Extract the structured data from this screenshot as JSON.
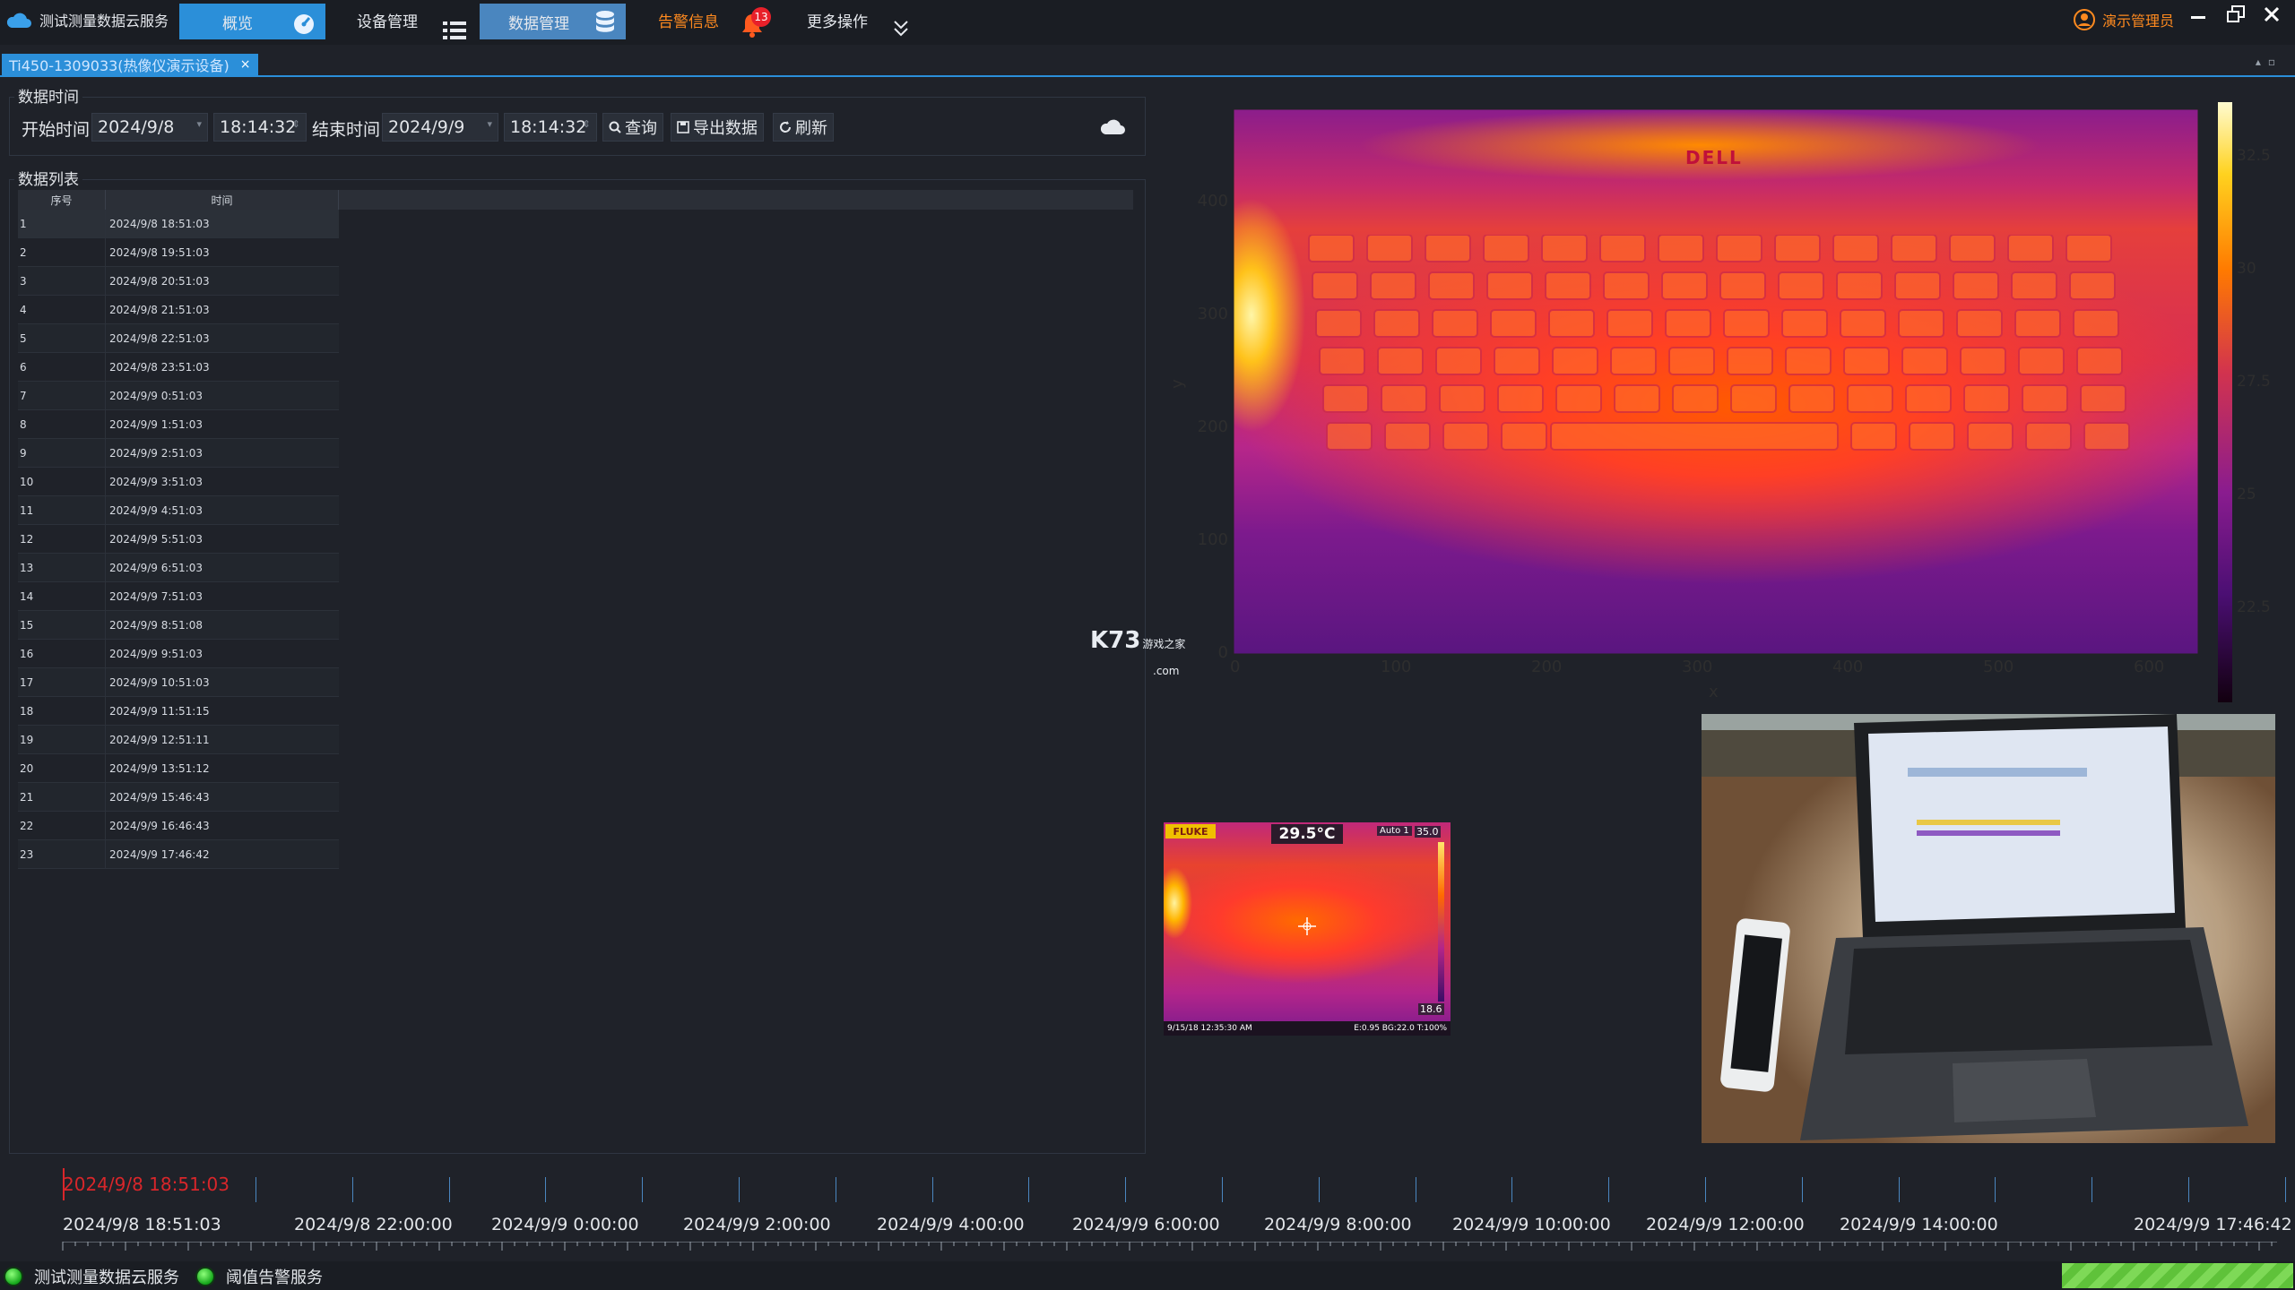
{
  "app": {
    "title": "测试测量数据云服务"
  },
  "nav": {
    "overview": "概览",
    "device_mgmt": "设备管理",
    "data_mgmt": "数据管理",
    "alarm_info": "告警信息",
    "alarm_count": "13",
    "more_ops": "更多操作"
  },
  "user": {
    "name": "演示管理员"
  },
  "tab": {
    "label": "Ti450-1309033(热像仪演示设备)",
    "close": "×"
  },
  "time_group": {
    "title": "数据时间",
    "start_label": "开始时间",
    "start_date": "2024/9/8",
    "start_time": "18:14:32",
    "end_label": "结束时间",
    "end_date": "2024/9/9",
    "end_time": "18:14:32",
    "query": "查询",
    "export": "导出数据",
    "refresh": "刷新"
  },
  "list_group": {
    "title": "数据列表",
    "columns": [
      "序号",
      "时间"
    ],
    "rows": [
      [
        "1",
        "2024/9/8 18:51:03"
      ],
      [
        "2",
        "2024/9/8 19:51:03"
      ],
      [
        "3",
        "2024/9/8 20:51:03"
      ],
      [
        "4",
        "2024/9/8 21:51:03"
      ],
      [
        "5",
        "2024/9/8 22:51:03"
      ],
      [
        "6",
        "2024/9/8 23:51:03"
      ],
      [
        "7",
        "2024/9/9 0:51:03"
      ],
      [
        "8",
        "2024/9/9 1:51:03"
      ],
      [
        "9",
        "2024/9/9 2:51:03"
      ],
      [
        "10",
        "2024/9/9 3:51:03"
      ],
      [
        "11",
        "2024/9/9 4:51:03"
      ],
      [
        "12",
        "2024/9/9 5:51:03"
      ],
      [
        "13",
        "2024/9/9 6:51:03"
      ],
      [
        "14",
        "2024/9/9 7:51:03"
      ],
      [
        "15",
        "2024/9/9 8:51:08"
      ],
      [
        "16",
        "2024/9/9 9:51:03"
      ],
      [
        "17",
        "2024/9/9 10:51:03"
      ],
      [
        "18",
        "2024/9/9 11:51:15"
      ],
      [
        "19",
        "2024/9/9 12:51:11"
      ],
      [
        "20",
        "2024/9/9 13:51:12"
      ],
      [
        "21",
        "2024/9/9 15:46:43"
      ],
      [
        "22",
        "2024/9/9 16:46:43"
      ],
      [
        "23",
        "2024/9/9 17:46:42"
      ]
    ]
  },
  "heatmap": {
    "xlabel": "x",
    "ylabel": "y",
    "x_ticks": [
      "0",
      "100",
      "200",
      "300",
      "400",
      "500",
      "600"
    ],
    "y_ticks": [
      "0",
      "100",
      "200",
      "300",
      "400"
    ],
    "colorbar_ticks": [
      "22.5",
      "25",
      "27.5",
      "30",
      "32.5"
    ],
    "brand_text": "DELL"
  },
  "thermal_camera": {
    "brand": "FLUKE",
    "center_temp": "29.5°C",
    "mode": "Auto 1",
    "scale_max": "35.0",
    "scale_min": "18.6",
    "timestamp": "9/15/18 12:35:30 AM",
    "params": "E:0.95 BG:22.0 T:100%"
  },
  "watermark": {
    "brand": "K73",
    "sub": "游戏之家",
    "domain": ".com"
  },
  "timeline": {
    "current": "2024/9/8 18:51:03",
    "labels": [
      "2024/9/8 18:51:03",
      "2024/9/8 22:00:00",
      "2024/9/9 0:00:00",
      "2024/9/9 2:00:00",
      "2024/9/9 4:00:00",
      "2024/9/9 6:00:00",
      "2024/9/9 8:00:00",
      "2024/9/9 10:00:00",
      "2024/9/9 12:00:00",
      "2024/9/9 14:00:00",
      "2024/9/9 17:46:42"
    ]
  },
  "status": {
    "service": "测试测量数据云服务",
    "threshold": "阈值告警服务"
  },
  "colors": {
    "accent": "#2b8fd9",
    "nav_data_bg": "#4a86bf",
    "alarm": "#ff8a1f",
    "badge": "#e8202a",
    "timeline_current": "#d8262a"
  }
}
